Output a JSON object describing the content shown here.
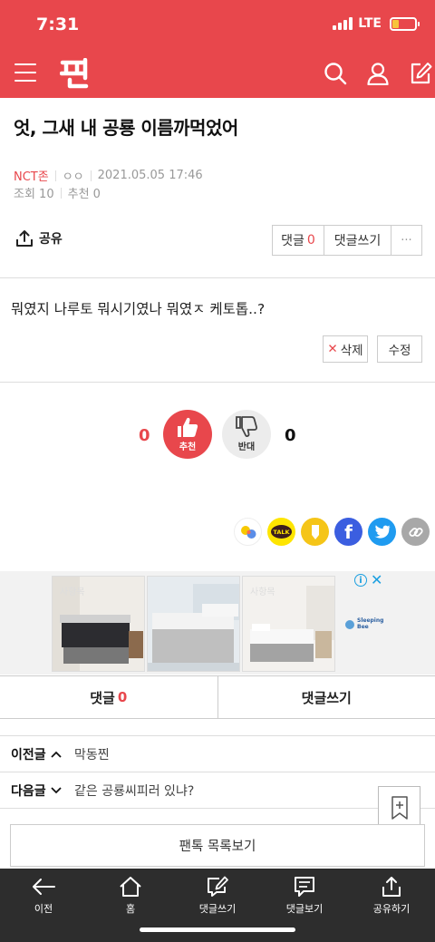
{
  "status": {
    "time": "7:31",
    "network": "LTE"
  },
  "header": {
    "logo_text": "판",
    "icons": [
      "menu-icon",
      "search-icon",
      "user-icon",
      "edit-icon"
    ]
  },
  "post": {
    "title": "엇, 그새 내 공룡 이름까먹었어",
    "category": "NCT존",
    "author": "ㅇㅇ",
    "datetime": "2021.05.05 17:46",
    "views": "조회 10",
    "recommend": "추천 0",
    "body": "뭐였지 나루토 뭐시기였나 뭐였ㅈ 케토톱..?"
  },
  "actions": {
    "share_label": "공유",
    "comment_label": "댓글",
    "comment_count": "0",
    "write_comment_label": "댓글쓰기",
    "more_label": "···",
    "delete_label": "삭제",
    "edit_label": "수정"
  },
  "vote": {
    "up_count": "0",
    "up_label": "추천",
    "down_label": "반대",
    "down_count": "0"
  },
  "share_services": [
    "kakaostory-icon",
    "kakaotalk-icon",
    "kakaopage-icon",
    "facebook-icon",
    "twitter-icon",
    "link-icon"
  ],
  "share_talk_text": "TALK",
  "ad": {
    "brand": "Sleeping Bee",
    "watermark": "사항목"
  },
  "comment_bar": {
    "comment_label": "댓글",
    "comment_count": "0",
    "write_label": "댓글쓰기"
  },
  "nav": {
    "prev_label": "이전글",
    "prev_title": "막동찐",
    "next_label": "다음글",
    "next_title": "같은 공룡씨피러 있냐?"
  },
  "list_button": "팬톡 목록보기",
  "bottom_nav": [
    {
      "label": "이전",
      "icon": "back-arrow-icon"
    },
    {
      "label": "홈",
      "icon": "home-icon"
    },
    {
      "label": "댓글쓰기",
      "icon": "write-comment-icon"
    },
    {
      "label": "댓글보기",
      "icon": "view-comment-icon"
    },
    {
      "label": "공유하기",
      "icon": "share-icon"
    }
  ],
  "colors": {
    "brand": "#e8474c",
    "nav_bg": "#2d2d2d"
  }
}
